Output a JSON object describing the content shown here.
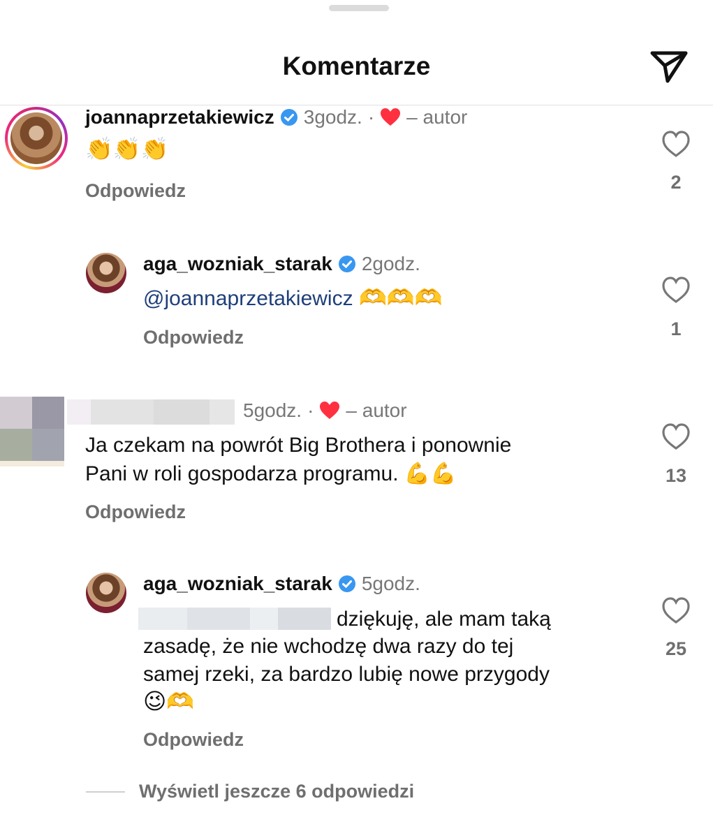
{
  "header": {
    "title": "Komentarze",
    "share_icon": "send-icon"
  },
  "comments": [
    {
      "username": "joannaprzetakiewicz",
      "verified": true,
      "time": "3godz.",
      "author_liked_suffix": "– autor",
      "text": "👏👏👏",
      "reply_label": "Odpowiedz",
      "likes": "2"
    },
    {
      "username": "aga_wozniak_starak",
      "verified": true,
      "time": "2godz.",
      "mention": "@joannaprzetakiewicz",
      "text": "🫶🫶🫶",
      "reply_label": "Odpowiedz",
      "likes": "1"
    },
    {
      "username_hidden": true,
      "time": "5godz.",
      "author_liked_suffix": "– autor",
      "text_line1": "Ja czekam na powrót Big Brothera i ponownie",
      "text_line2": "Pani w roli gospodarza programu. 💪💪",
      "reply_label": "Odpowiedz",
      "likes": "13"
    },
    {
      "username": "aga_wozniak_starak",
      "verified": true,
      "time": "5godz.",
      "text_line1": "dziękuję, ale mam taką",
      "text_line2": "zasadę, że nie wchodzę dwa razy do tej",
      "text_line3": "samej rzeki, za bardzo lubię nowe przygody",
      "text_line4": "😉🫶",
      "reply_label": "Odpowiedz",
      "likes": "25"
    }
  ],
  "view_more": {
    "label": "Wyświetl jeszcze 6 odpowiedzi"
  },
  "colors": {
    "heart_red": "#ff3040",
    "verified_blue": "#3897f0",
    "meta_gray": "#777777"
  }
}
